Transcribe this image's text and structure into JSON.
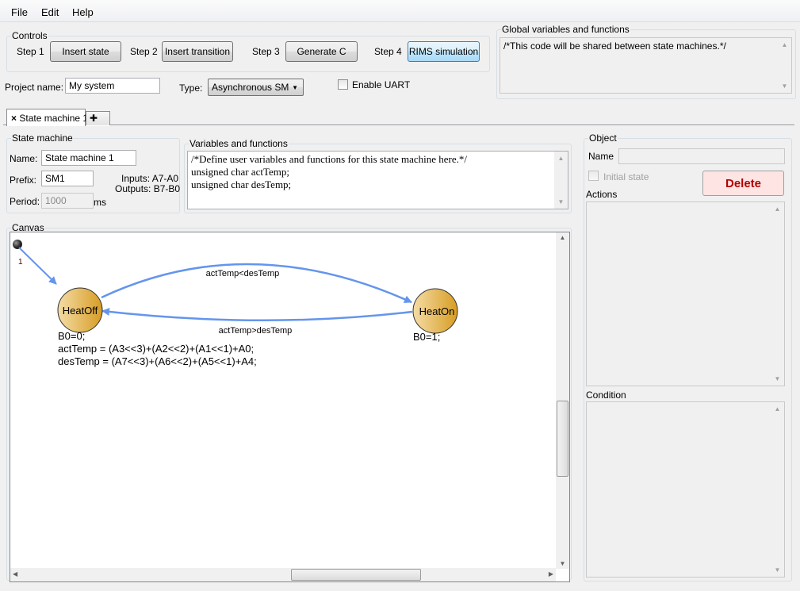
{
  "menu": [
    "File",
    "Edit",
    "Help"
  ],
  "controls": {
    "title": "Controls",
    "steps": [
      {
        "step": "Step 1",
        "button": "Insert state"
      },
      {
        "step": "Step 2",
        "button": "Insert transition"
      },
      {
        "step": "Step 3",
        "button": "Generate C"
      },
      {
        "step": "Step 4",
        "button": "RIMS simulation"
      }
    ]
  },
  "project": {
    "name_label": "Project name:",
    "name_value": "My system",
    "type_label": "Type:",
    "type_value": "Asynchronous SM",
    "uart_label": "Enable UART"
  },
  "global": {
    "title": "Global variables and functions",
    "code": "/*This code will be shared between state machines.*/"
  },
  "tabs": {
    "active": "State machine 1",
    "close_icon": "×",
    "add_icon": "✚"
  },
  "state_machine": {
    "title": "State machine",
    "name_label": "Name:",
    "name_value": "State machine 1",
    "prefix_label": "Prefix:",
    "prefix_value": "SM1",
    "inputs": "Inputs: A7-A0",
    "outputs": "Outputs: B7-B0",
    "period_label": "Period:",
    "period_value": "1000",
    "period_unit": "ms"
  },
  "variables": {
    "title": "Variables and functions",
    "lines": [
      "/*Define user variables and functions for this state machine here.*/",
      "unsigned char actTemp;",
      "unsigned char desTemp;"
    ]
  },
  "canvas": {
    "title": "Canvas",
    "initial_label": "1",
    "states": [
      {
        "name": "HeatOff",
        "actions": [
          "B0=0;",
          "actTemp = (A3<<3)+(A2<<2)+(A1<<1)+A0;",
          "desTemp = (A7<<3)+(A6<<2)+(A5<<1)+A4;"
        ]
      },
      {
        "name": "HeatOn",
        "actions": [
          "B0=1;"
        ]
      }
    ],
    "transitions": [
      {
        "from": "HeatOff",
        "to": "HeatOn",
        "condition": "actTemp<desTemp"
      },
      {
        "from": "HeatOn",
        "to": "HeatOff",
        "condition": "actTemp>desTemp"
      }
    ]
  },
  "object": {
    "title": "Object",
    "name_label": "Name",
    "initial_state_label": "Initial state",
    "delete_label": "Delete",
    "actions_label": "Actions",
    "condition_label": "Condition"
  },
  "colors": {
    "state_fill": "#e2b04a",
    "transition": "#6495ed",
    "delete_bg": "#ffe4e4",
    "delete_text": "#b00000"
  }
}
